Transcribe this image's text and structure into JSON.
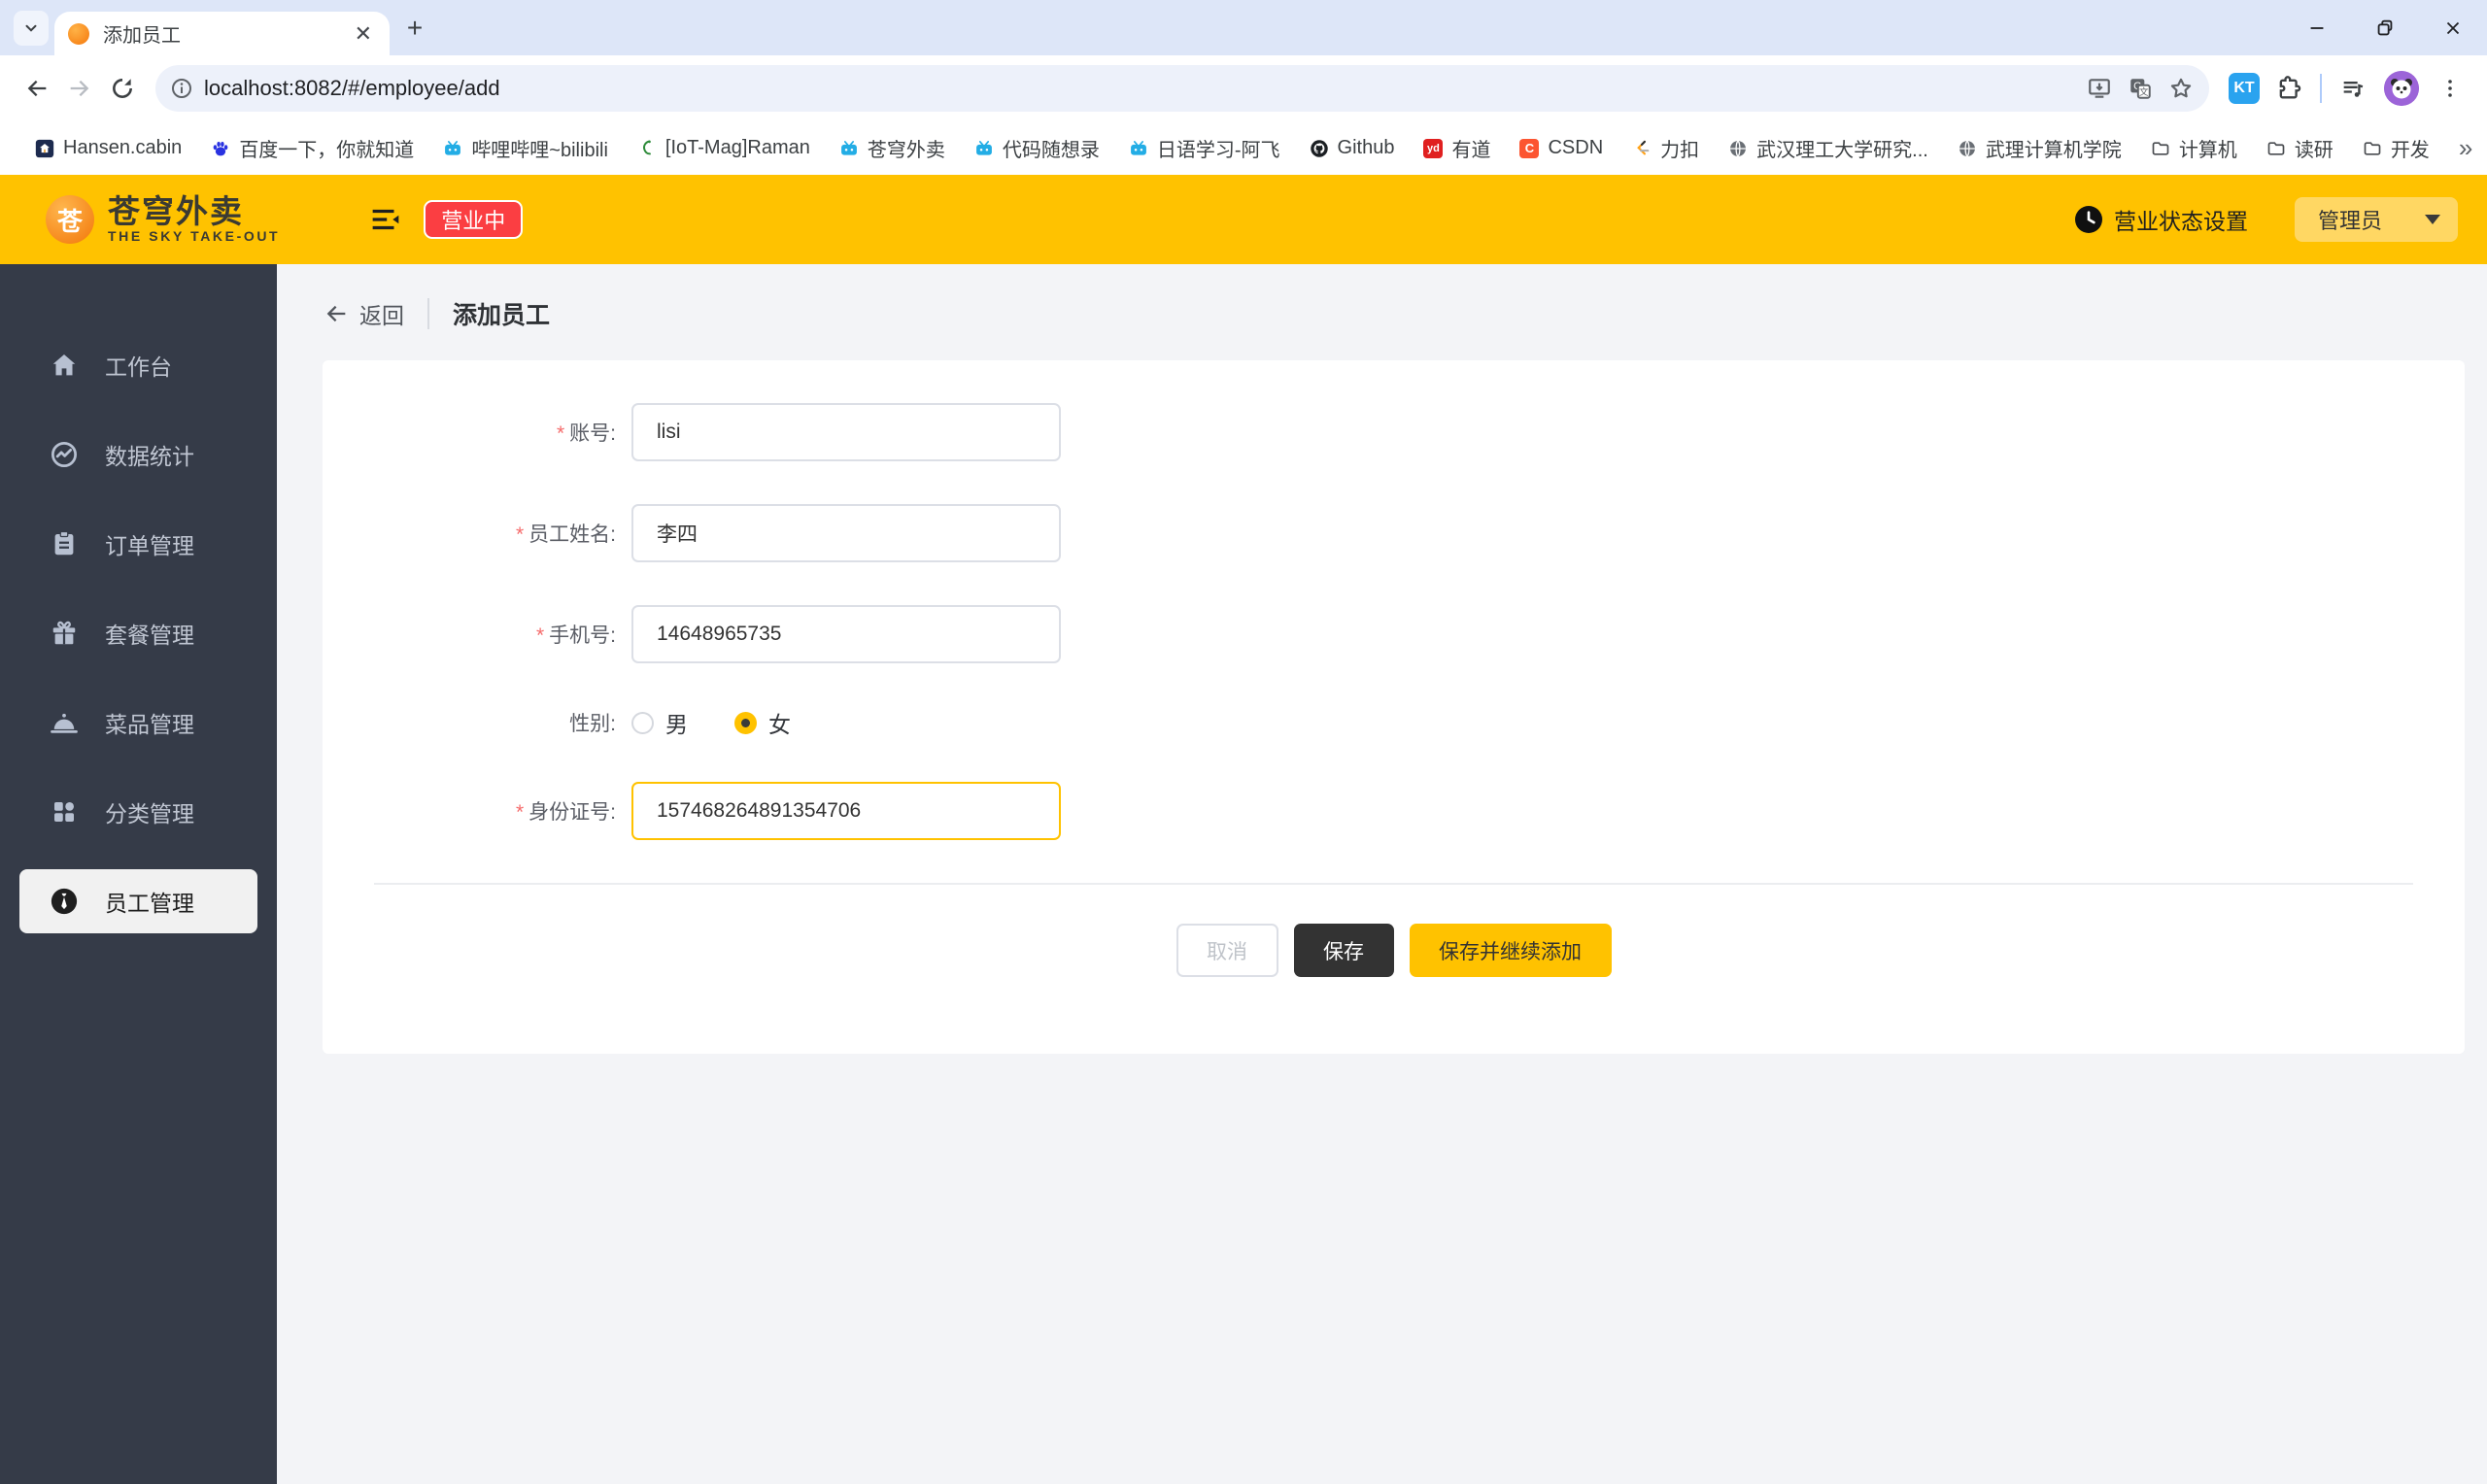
{
  "browser": {
    "tab_title": "添加员工",
    "url": "localhost:8082/#/employee/add",
    "kt_badge": "KT",
    "bookmarks_overflow": "»",
    "favicon_glyphs": {
      "youdao": "yd",
      "csdn": "C",
      "logo": "苍"
    },
    "bookmarks": [
      {
        "label": "Hansen.cabin"
      },
      {
        "label": "百度一下，你就知道"
      },
      {
        "label": "哔哩哔哩~bilibili"
      },
      {
        "label": "[IoT-Mag]Raman"
      },
      {
        "label": "苍穹外卖"
      },
      {
        "label": "代码随想录"
      },
      {
        "label": "日语学习-阿飞"
      },
      {
        "label": "Github"
      },
      {
        "label": "有道"
      },
      {
        "label": "CSDN"
      },
      {
        "label": "力扣"
      },
      {
        "label": "武汉理工大学研究..."
      },
      {
        "label": "武理计算机学院"
      },
      {
        "label": "计算机"
      },
      {
        "label": "读研"
      },
      {
        "label": "开发"
      }
    ]
  },
  "header": {
    "logo_char": "苍",
    "brand_name": "苍穹外卖",
    "brand_tagline": "THE SKY TAKE-OUT",
    "status_badge": "营业中",
    "status_setting": "营业状态设置",
    "user_menu": "管理员"
  },
  "sidebar": {
    "items": [
      {
        "label": "工作台"
      },
      {
        "label": "数据统计"
      },
      {
        "label": "订单管理"
      },
      {
        "label": "套餐管理"
      },
      {
        "label": "菜品管理"
      },
      {
        "label": "分类管理"
      },
      {
        "label": "员工管理",
        "active": true
      }
    ]
  },
  "page": {
    "back_label": "返回",
    "title": "添加员工",
    "required_mark": "*",
    "form": {
      "account": {
        "label": "账号:",
        "value": "lisi"
      },
      "name": {
        "label": "员工姓名:",
        "value": "李四"
      },
      "phone": {
        "label": "手机号:",
        "value": "14648965735"
      },
      "gender": {
        "label": "性别:",
        "options": [
          "男",
          "女"
        ],
        "selected": "女"
      },
      "id_number": {
        "label": "身份证号:",
        "value": "157468264891354706",
        "focused": true
      }
    },
    "buttons": {
      "cancel": "取消",
      "save": "保存",
      "save_continue": "保存并继续添加"
    }
  },
  "colors": {
    "brand_yellow": "#ffc200",
    "badge_red": "#fb3e42",
    "sidebar_bg": "#353b48",
    "page_bg": "#f3f4f7",
    "focus_border": "#ffc200"
  }
}
